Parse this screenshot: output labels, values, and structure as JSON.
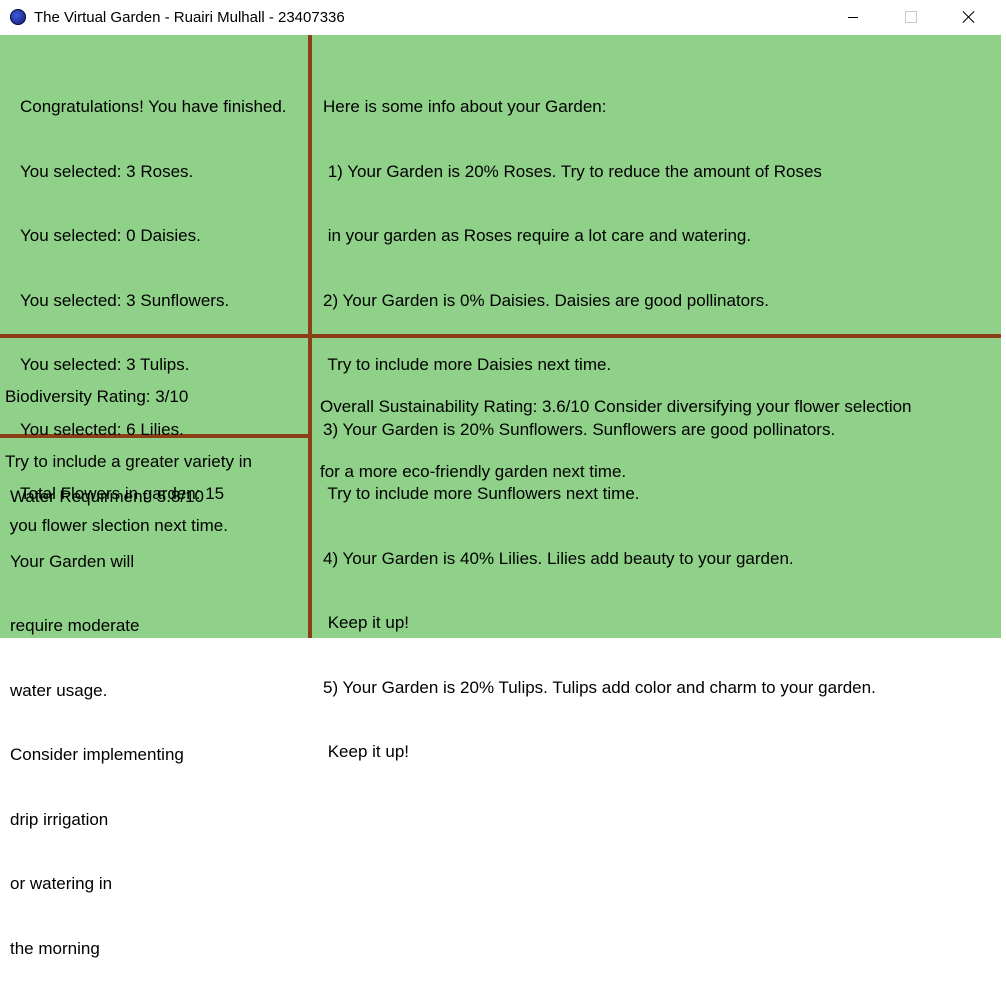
{
  "window": {
    "title": "The Virtual Garden - Ruairi Mulhall - 23407336",
    "icon": "app-globe-icon",
    "controls": [
      "minimize",
      "maximize",
      "close"
    ]
  },
  "colors": {
    "panel_bg": "#8fd188",
    "divider": "#8b3f17"
  },
  "summary": {
    "lines": [
      "Congratulations! You have finished.",
      "You selected: 3 Roses.",
      "You selected: 0 Daisies.",
      "You selected: 3 Sunflowers.",
      "You selected: 3 Tulips.",
      "You selected: 6 Lilies.",
      "Total Flowers in garden: 15"
    ]
  },
  "info": {
    "lines": [
      "Here is some info about your Garden:",
      " 1) Your Garden is 20% Roses. Try to reduce the amount of Roses",
      " in your garden as Roses require a lot care and watering.",
      "2) Your Garden is 0% Daisies. Daisies are good pollinators.",
      " Try to include more Daisies next time.",
      "3) Your Garden is 20% Sunflowers. Sunflowers are good pollinators.",
      " Try to include more Sunflowers next time.",
      "4) Your Garden is 40% Lilies. Lilies add beauty to your garden.",
      " Keep it up!",
      "5) Your Garden is 20% Tulips. Tulips add color and charm to your garden.",
      " Keep it up!"
    ]
  },
  "biodiversity": {
    "lines": [
      "Biodiversity Rating: 3/10",
      "Try to include a greater variety in",
      " you flower slection next time."
    ]
  },
  "water": {
    "lines": [
      "Water Requirment: 5.8/10",
      "Your Garden will",
      "require moderate",
      "water usage.",
      "Consider implementing",
      "drip irrigation",
      "or watering in",
      "the morning"
    ]
  },
  "overall": {
    "lines": [
      "Overall Sustainability Rating: 3.6/10 Consider diversifying your flower selection",
      "for a more eco-friendly garden next time."
    ]
  }
}
